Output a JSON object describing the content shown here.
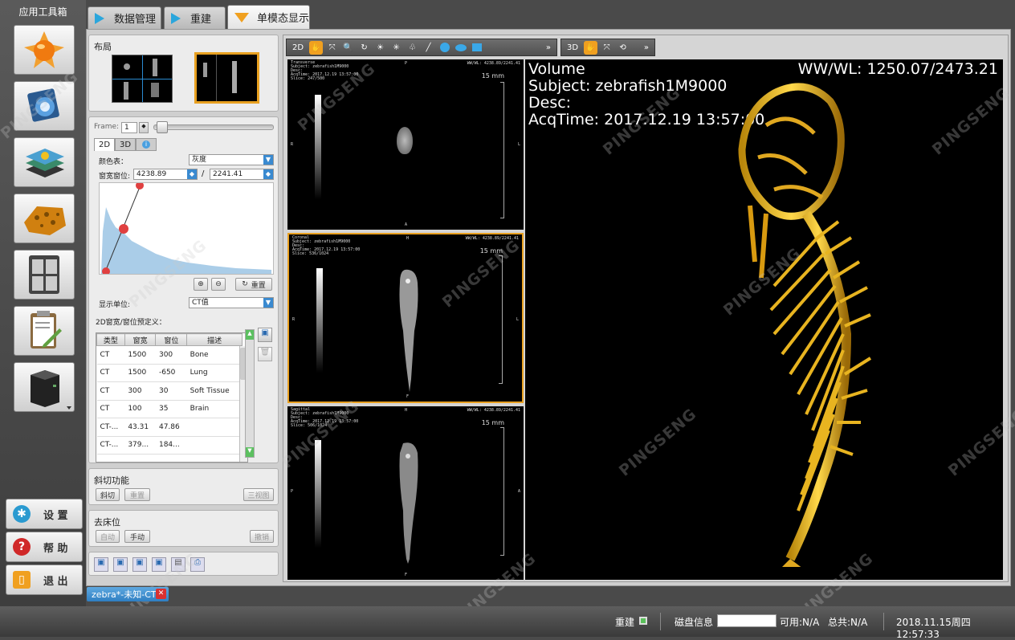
{
  "toolbox": {
    "title": "应用工具箱",
    "items": [
      "energy-sphere-icon",
      "slice-viewer-icon",
      "layer-stack-icon",
      "porous-material-icon",
      "quad-view-icon",
      "report-clipboard-icon",
      "server-icon"
    ]
  },
  "sys": {
    "settings": "设 置",
    "help": "帮 助",
    "exit": "退 出"
  },
  "tabs": [
    {
      "label": "数据管理"
    },
    {
      "label": "重建"
    },
    {
      "label": "单模态显示"
    }
  ],
  "layout": {
    "title": "布局"
  },
  "frame": {
    "label": "Frame:",
    "value": "1"
  },
  "view_tabs": {
    "t2d": "2D",
    "t3d": "3D"
  },
  "colormap": {
    "label": "颜色表：",
    "value": "灰度"
  },
  "window": {
    "label": "窗宽窗位:",
    "width": "4238.89",
    "sep": "/",
    "level": "2241.41"
  },
  "hist_buttons": {
    "reset": "重置"
  },
  "unit": {
    "label": "显示单位:",
    "value": "CT值"
  },
  "presets": {
    "title": "2D窗宽/窗位预定义：",
    "headers": [
      "类型",
      "窗宽",
      "窗位",
      "描述"
    ],
    "rows": [
      [
        "CT",
        "1500",
        "300",
        "Bone"
      ],
      [
        "CT",
        "1500",
        "-650",
        "Lung"
      ],
      [
        "CT",
        "300",
        "30",
        "Soft Tissue"
      ],
      [
        "CT",
        "100",
        "35",
        "Brain"
      ],
      [
        "CT-...",
        "43.31",
        "47.86",
        ""
      ],
      [
        "CT-...",
        "379...",
        "184...",
        ""
      ],
      [
        "...",
        "...",
        "...",
        ""
      ]
    ]
  },
  "oblique": {
    "title": "斜切功能",
    "cut": "斜切",
    "reset": "重置",
    "three": "三视图"
  },
  "bed": {
    "title": "去床位",
    "auto": "自动",
    "manual": "手动",
    "undo": "撤销"
  },
  "viewer": {
    "tb2d_label": "2D",
    "tb3d_label": "3D",
    "more": "»"
  },
  "vp_axial": {
    "l1": "Transverse",
    "l2": "Subject: zebrafish1M9000",
    "l3": "Desc:",
    "l4": "AcqTime: 2017.12.19 13:57:00",
    "l5": "Slice: 247/500",
    "wl": "WW/WL: 4238.89/2241.41",
    "mm": "15 mm",
    "top": "P",
    "bottom": "A",
    "left": "R",
    "right": "L"
  },
  "vp_coronal": {
    "l1": "Coronal",
    "l2": "Subject: zebrafish1M9000",
    "l3": "Desc:",
    "l4": "AcqTime: 2017.12.19 13:57:00",
    "l5": "Slice: 536/1024",
    "wl": "WW/WL: 4238.89/2241.41",
    "mm": "15 mm",
    "top": "H",
    "bottom": "F",
    "left": "R",
    "right": "L"
  },
  "vp_sagittal": {
    "l1": "Sagittal",
    "l2": "Subject: zebrafish1M9000",
    "l3": "Desc:",
    "l4": "AcqTime: 2017.12.19 13:57:00",
    "l5": "Slice: 506/1024",
    "wl": "WW/WL: 4238.89/2241.41",
    "mm": "15 mm",
    "top": "H",
    "bottom": "F",
    "left": "P",
    "right": "A"
  },
  "vp_3d": {
    "volume": "Volume",
    "subject": "Subject: zebrafish1M9000",
    "desc": "Desc:",
    "acq": "AcqTime: 2017.12.19 13:57:00",
    "wl": "WW/WL: 1250.07/2473.21"
  },
  "filetab": {
    "label": "zebra*-未知-CT",
    "close": "✕"
  },
  "status": {
    "recon": "重建",
    "disk": "磁盘信息",
    "avail": "可用:N/A",
    "total": "总共:N/A",
    "datetime": "2018.11.15周四 12:57:33"
  },
  "watermark": "PINGSENG",
  "colors": {
    "accent": "#2aa6dc",
    "highlight": "#f0a020",
    "bone": "#e8b820"
  }
}
